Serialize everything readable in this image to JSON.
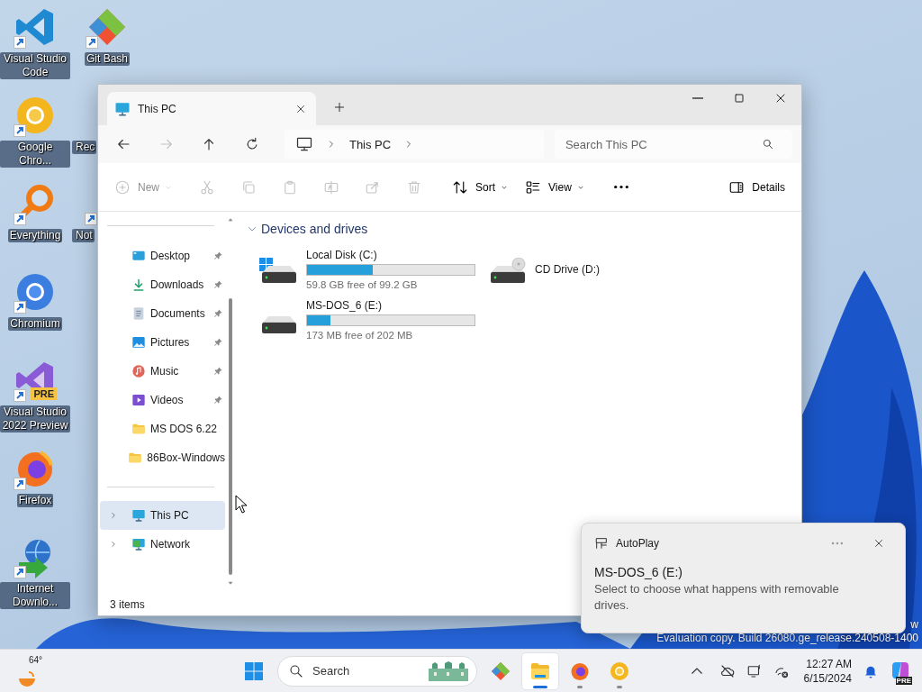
{
  "desktop": {
    "columns": [
      [
        {
          "label": "Visual Studio Code",
          "kind": "vscode",
          "shortcut": true
        },
        {
          "label": "Google Chro...",
          "kind": "chrome",
          "shortcut": true
        },
        {
          "label": "Everything",
          "kind": "everything",
          "shortcut": true
        },
        {
          "label": "Chromium",
          "kind": "chromium",
          "shortcut": true
        },
        {
          "label": "Visual Studio 2022 Preview",
          "kind": "vs_preview",
          "shortcut": true,
          "badge": "PRE"
        },
        {
          "label": "Firefox",
          "kind": "firefox",
          "shortcut": true
        },
        {
          "label": "Internet Downlo...",
          "kind": "idm",
          "shortcut": true
        }
      ],
      [
        {
          "label": "Git Bash",
          "kind": "gitbash",
          "shortcut": true
        },
        {
          "label": "Rec",
          "kind": "recycle",
          "shortcut": false,
          "partly_hidden": true
        },
        {
          "label": "Not",
          "kind": "notepad",
          "shortcut": true,
          "partly_hidden": true
        }
      ]
    ]
  },
  "explorer": {
    "tabs": [
      {
        "title": "This PC",
        "selected": true
      }
    ],
    "nav_buttons": [
      {
        "kind": "back",
        "disabled": false
      },
      {
        "kind": "forward",
        "disabled": true
      },
      {
        "kind": "up",
        "disabled": false
      },
      {
        "kind": "refresh",
        "disabled": false
      }
    ],
    "breadcrumb": [
      "This PC"
    ],
    "search": {
      "placeholder": "Search This PC"
    },
    "toolbar": [
      {
        "kind": "new",
        "label": "New",
        "disabled": true,
        "dropdown": true
      },
      {
        "kind": "cut",
        "disabled": true
      },
      {
        "kind": "copy",
        "disabled": true
      },
      {
        "kind": "paste",
        "disabled": true
      },
      {
        "kind": "rename",
        "disabled": true
      },
      {
        "kind": "share",
        "disabled": true
      },
      {
        "kind": "delete",
        "disabled": true
      },
      {
        "kind": "sort",
        "label": "Sort",
        "disabled": false,
        "dropdown": true
      },
      {
        "kind": "view",
        "label": "View",
        "disabled": false,
        "dropdown": true
      },
      {
        "kind": "more",
        "disabled": false
      },
      {
        "kind": "details",
        "label": "Details",
        "disabled": false
      }
    ],
    "nav_pane": {
      "quick_access": [
        {
          "label": "Desktop",
          "kind": "desktop",
          "pinned": true,
          "selected": false
        },
        {
          "label": "Downloads",
          "kind": "downloads",
          "pinned": true,
          "selected": false
        },
        {
          "label": "Documents",
          "kind": "documents",
          "pinned": true,
          "selected": false
        },
        {
          "label": "Pictures",
          "kind": "pictures",
          "pinned": true,
          "selected": false
        },
        {
          "label": "Music",
          "kind": "music",
          "pinned": true,
          "selected": false
        },
        {
          "label": "Videos",
          "kind": "videos",
          "pinned": true,
          "selected": false
        },
        {
          "label": "MS DOS 6.22",
          "kind": "folder",
          "pinned": false,
          "selected": false
        },
        {
          "label": "86Box-Windows",
          "kind": "folder",
          "pinned": false,
          "selected": false
        }
      ],
      "locations": [
        {
          "label": "This PC",
          "kind": "pc",
          "expanded": false,
          "selected": true
        },
        {
          "label": "Network",
          "kind": "network",
          "expanded": false,
          "selected": false
        }
      ]
    },
    "section": {
      "title": "Devices and drives",
      "expanded": true,
      "drives": [
        {
          "name": "Local Disk (C:)",
          "kind": "system",
          "level": 0.39,
          "free": "59.8 GB free of 99.2 GB"
        },
        {
          "name": "CD Drive (D:)",
          "kind": "cd"
        },
        {
          "name": "MS-DOS_6 (E:)",
          "kind": "removable",
          "level": 0.14,
          "free": "173 MB free of 202 MB"
        }
      ]
    },
    "status": "3 items"
  },
  "desktop_notice": [
    "w",
    "Evaluation copy. Build 26080.ge_release.240508-1400"
  ],
  "toast": {
    "app": "AutoPlay",
    "title": "MS-DOS_6 (E:)",
    "body": "Select to choose what happens with removable drives."
  },
  "taskbar": {
    "weather": "64°",
    "search": {
      "placeholder": "Search"
    },
    "apps": [
      {
        "kind": "gem",
        "running": false,
        "active": false
      },
      {
        "kind": "explorer",
        "running": true,
        "active": true
      },
      {
        "kind": "firefox",
        "running": true,
        "active": false
      },
      {
        "kind": "canary",
        "running": true,
        "active": false
      }
    ],
    "tray": [
      {
        "kind": "chevron"
      },
      {
        "kind": "cloud_off"
      },
      {
        "kind": "display"
      },
      {
        "kind": "network_off"
      }
    ],
    "clock": {
      "time": "12:27 AM",
      "date": "6/15/2024"
    },
    "copilot": {
      "badge": "PRE"
    }
  }
}
